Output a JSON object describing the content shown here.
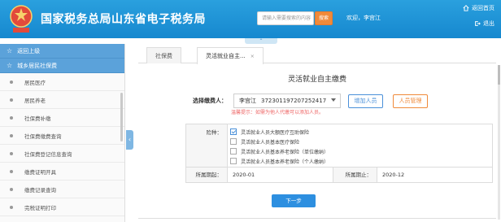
{
  "header": {
    "title": "国家税务总局山东省电子税务局",
    "search_placeholder": "请输入需要搜索的内容",
    "search_button": "搜索",
    "welcome": "欢迎，李宫江",
    "home_link": "返回首页",
    "logout_link": "退出",
    "colors": {
      "header_bg": "#1688cf",
      "accent": "#f08a3a"
    }
  },
  "sidebar": {
    "back_label": "返回上级",
    "section_label": "城乡居民社保费",
    "items": [
      {
        "label": "居民医疗"
      },
      {
        "label": "居民养老"
      },
      {
        "label": "社保费补缴"
      },
      {
        "label": "社保费缴费查询"
      },
      {
        "label": "社保费登记信息查询"
      },
      {
        "label": "缴费证明开具"
      },
      {
        "label": "缴费记录查询"
      },
      {
        "label": "完税证明打印"
      }
    ]
  },
  "tabs": [
    {
      "label": "社保费",
      "active": false
    },
    {
      "label": "灵活就业自主...",
      "active": true,
      "close": "×"
    }
  ],
  "form": {
    "title": "灵活就业自主缴费",
    "payer_label": "选择缴费人：",
    "payer_name": "李宫江",
    "payer_id": "372301197207252417",
    "add_button": "增加人员",
    "manage_button": "人员管理",
    "hint": "温馨提示：如需为他人代缴可以添加人员。",
    "insurance_label": "险种：",
    "insurance_options": [
      {
        "label": "灵活就业人员大额医疗互助保险",
        "checked": true
      },
      {
        "label": "灵活就业人员基本医疗保险",
        "checked": false
      },
      {
        "label": "灵活就业人员基本养老保险（单位缴纳）",
        "checked": false
      },
      {
        "label": "灵活就业人员基本养老保险（个人缴纳）",
        "checked": false
      }
    ],
    "period_start_label": "所属期起：",
    "period_start": "2020-01",
    "period_end_label": "所属期止：",
    "period_end": "2020-12",
    "next_button": "下一步"
  }
}
